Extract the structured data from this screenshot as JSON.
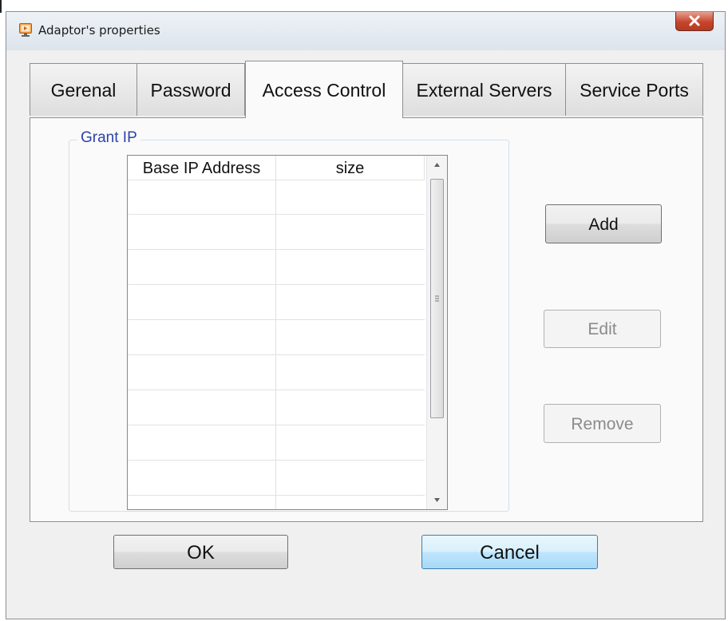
{
  "window": {
    "title": "Adaptor's properties",
    "close_icon": "close-icon"
  },
  "tabs": [
    {
      "label": "Gerenal",
      "active": false
    },
    {
      "label": "Password",
      "active": false
    },
    {
      "label": "Access Control",
      "active": true
    },
    {
      "label": "External Servers",
      "active": false
    },
    {
      "label": "Service Ports",
      "active": false
    }
  ],
  "grant_ip": {
    "group_label": "Grant IP",
    "columns": [
      "Base IP Address",
      "size"
    ],
    "rows": []
  },
  "side_buttons": {
    "add": "Add",
    "edit": "Edit",
    "remove": "Remove"
  },
  "footer": {
    "ok": "OK",
    "cancel": "Cancel"
  },
  "colors": {
    "group_label": "#2d43a8",
    "close_button": "#c7452c",
    "default_button_border": "#3c7fb1"
  }
}
